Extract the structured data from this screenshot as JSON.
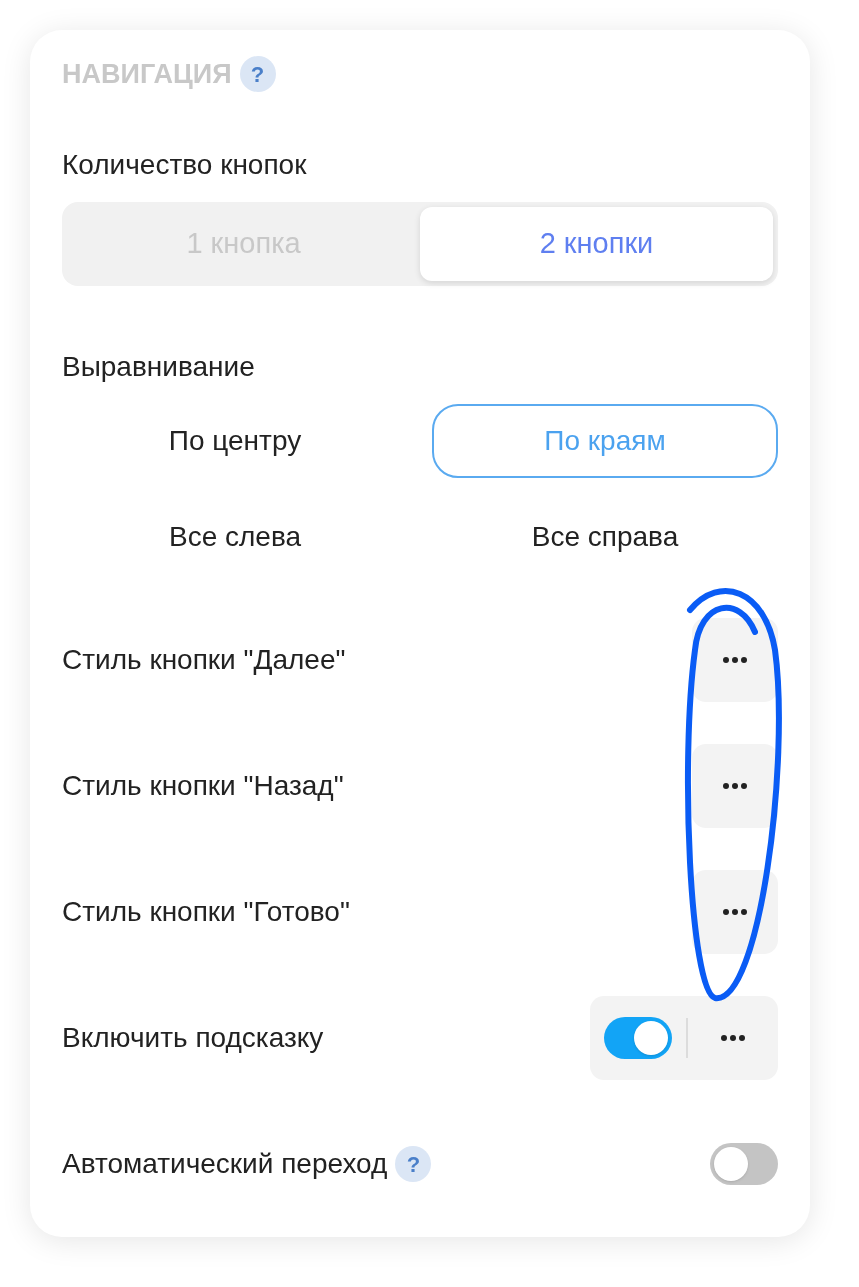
{
  "section": {
    "title": "НАВИГАЦИЯ",
    "help": "?"
  },
  "button_count": {
    "label": "Количество кнопок",
    "options": [
      {
        "label": "1 кнопка",
        "selected": false
      },
      {
        "label": "2 кнопки",
        "selected": true
      }
    ]
  },
  "alignment": {
    "label": "Выравнивание",
    "options": [
      {
        "label": "По центру",
        "selected": false
      },
      {
        "label": "По краям",
        "selected": true
      },
      {
        "label": "Все слева",
        "selected": false
      },
      {
        "label": "Все справа",
        "selected": false
      }
    ]
  },
  "settings": [
    {
      "kind": "style",
      "label": "Стиль кнопки \"Далее\""
    },
    {
      "kind": "style",
      "label": "Стиль кнопки \"Назад\""
    },
    {
      "kind": "style",
      "label": "Стиль кнопки \"Готово\""
    },
    {
      "kind": "toggle_style",
      "label": "Включить подсказку",
      "on": true
    },
    {
      "kind": "toggle",
      "label": "Автоматический переход",
      "help": "?",
      "on": false
    }
  ]
}
